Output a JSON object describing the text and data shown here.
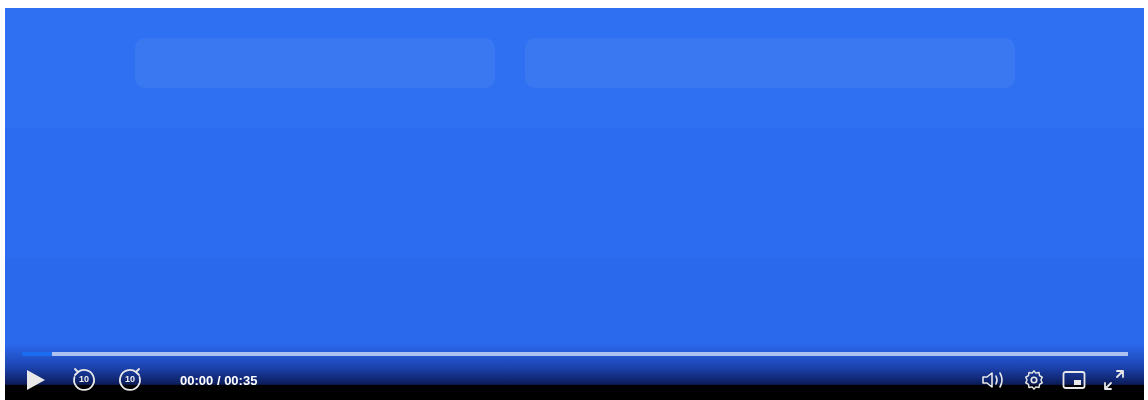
{
  "progress": {
    "level": 0.027
  },
  "left_controls": [
    {
      "kind": "play"
    },
    {
      "kind": "rewind",
      "label": "10"
    },
    {
      "kind": "forward",
      "label": "10"
    }
  ],
  "time": {
    "current": "00:00",
    "separator": "/",
    "duration": "00:35"
  },
  "right_controls": [
    {
      "kind": "volume"
    },
    {
      "kind": "settings"
    },
    {
      "kind": "pip"
    },
    {
      "kind": "fullscreen"
    }
  ]
}
